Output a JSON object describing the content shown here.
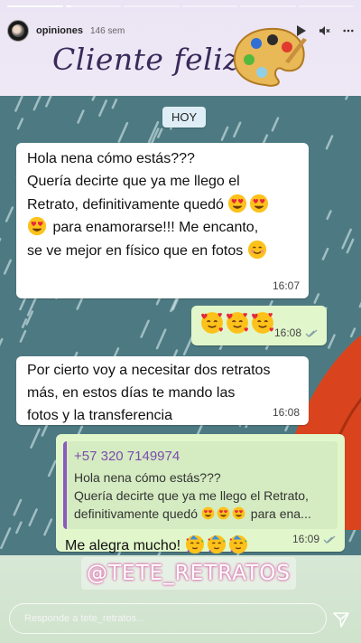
{
  "story": {
    "progress": [
      1,
      0.1,
      0,
      0,
      0,
      0
    ],
    "username": "opiniones",
    "time_ago": "146 sem",
    "title": "Cliente feliz!",
    "handle": "@TETE_RETRATOS",
    "reply_placeholder": "Responde a tete_retratos..."
  },
  "chat": {
    "date_chip": "HOY",
    "m1": {
      "lines": [
        "Hola nena cómo estás???",
        "Quería decirte que ya me llego el",
        "Retrato, definitivamente quedó",
        "para enamorarse!!! Me encanto,",
        "se ve mejor en físico que en fotos"
      ],
      "time": "16:07"
    },
    "m2": {
      "time": "16:08"
    },
    "m3": {
      "lines": [
        "Por cierto voy a necesitar dos retratos",
        "más, en estos días te mando las",
        "fotos y la transferencia"
      ],
      "time": "16:08"
    },
    "m4": {
      "quote_number": "+57 320 7149974",
      "quote_lines": [
        "Hola nena cómo estás???",
        "Quería decirte que ya me llego el Retrato,",
        "definitivamente quedó",
        "para ena..."
      ],
      "text": "Me alegra mucho!",
      "time": "16:09"
    }
  },
  "icons": {
    "play": "play-icon",
    "mute": "speaker-muted-icon",
    "more": "more-horizontal-icon",
    "send": "send-icon",
    "palette": "palette-icon"
  },
  "colors": {
    "chat_bg": "#4d7a82",
    "outgoing": "#e1f7cb",
    "incoming": "#ffffff",
    "title": "#3a2a5a",
    "quote_accent": "#8a5bbd"
  }
}
